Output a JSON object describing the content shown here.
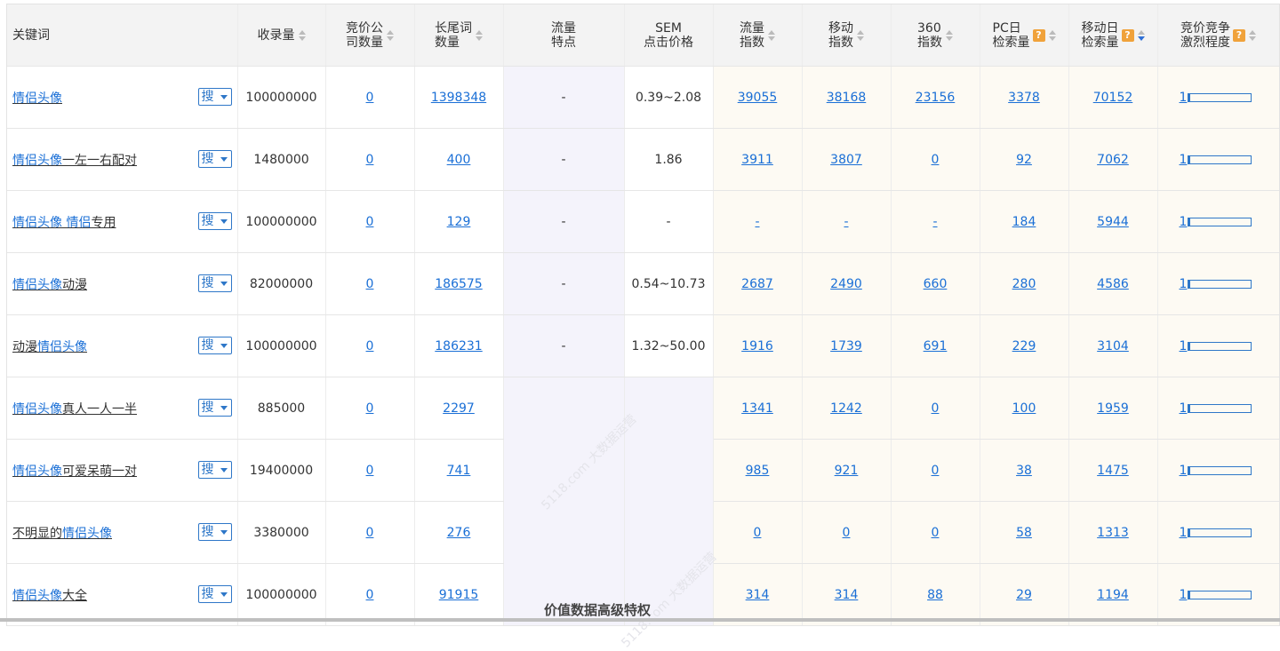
{
  "header": {
    "keyword": "关键词",
    "indexed": "收录量",
    "bid_companies": [
      "竞价公",
      "司数量"
    ],
    "longtail": [
      "长尾词",
      "数量"
    ],
    "traffic_feature": [
      "流量",
      "特点"
    ],
    "sem": [
      "SEM",
      "点击价格"
    ],
    "traffic_index": [
      "流量",
      "指数"
    ],
    "mobile_index": [
      "移动",
      "指数"
    ],
    "index_360": [
      "360",
      "指数"
    ],
    "pc_daily": [
      "PC日",
      "检索量"
    ],
    "mobile_daily": [
      "移动日",
      "检索量"
    ],
    "competition": [
      "竞价竞争",
      "激烈程度"
    ],
    "help_mark": "?"
  },
  "search_button_label": "搜",
  "rows": [
    {
      "kw_pre": "",
      "kw_hl": "情侣头像",
      "kw_post": "",
      "indexed": "100000000",
      "bid": "0",
      "longtail": "1398348",
      "feature": "-",
      "sem": "0.39~2.08",
      "traffic": "39055",
      "mobile": "38168",
      "i360": "23156",
      "pc": "3378",
      "mdaily": "70152",
      "comp": "1",
      "comp_level": 0.02
    },
    {
      "kw_pre": "",
      "kw_hl": "情侣头像",
      "kw_post": "一左一右配对",
      "indexed": "1480000",
      "bid": "0",
      "longtail": "400",
      "feature": "-",
      "sem": "1.86",
      "traffic": "3911",
      "mobile": "3807",
      "i360": "0",
      "pc": "92",
      "mdaily": "7062",
      "comp": "1",
      "comp_level": 0.02
    },
    {
      "kw_pre": "",
      "kw_hl": "情侣头像 情侣",
      "kw_post": "专用",
      "indexed": "100000000",
      "bid": "0",
      "longtail": "129",
      "feature": "-",
      "sem": "-",
      "traffic": "-",
      "mobile": "-",
      "i360": "-",
      "pc": "184",
      "mdaily": "5944",
      "comp": "1",
      "comp_level": 0.02
    },
    {
      "kw_pre": "",
      "kw_hl": "情侣头像",
      "kw_post": "动漫",
      "indexed": "82000000",
      "bid": "0",
      "longtail": "186575",
      "feature": "-",
      "sem": "0.54~10.73",
      "traffic": "2687",
      "mobile": "2490",
      "i360": "660",
      "pc": "280",
      "mdaily": "4586",
      "comp": "1",
      "comp_level": 0.02
    },
    {
      "kw_pre": "动漫",
      "kw_hl": "情侣头像",
      "kw_post": "",
      "indexed": "100000000",
      "bid": "0",
      "longtail": "186231",
      "feature": "-",
      "sem": "1.32~50.00",
      "traffic": "1916",
      "mobile": "1739",
      "i360": "691",
      "pc": "229",
      "mdaily": "3104",
      "comp": "1",
      "comp_level": 0.02
    },
    {
      "kw_pre": "",
      "kw_hl": "情侣头像",
      "kw_post": "真人一人一半",
      "indexed": "885000",
      "bid": "0",
      "longtail": "2297",
      "feature": "",
      "sem": "",
      "traffic": "1341",
      "mobile": "1242",
      "i360": "0",
      "pc": "100",
      "mdaily": "1959",
      "comp": "1",
      "comp_level": 0.02
    },
    {
      "kw_pre": "",
      "kw_hl": "情侣头像",
      "kw_post": "可爱呆萌一对",
      "indexed": "19400000",
      "bid": "0",
      "longtail": "741",
      "feature": "",
      "sem": "",
      "traffic": "985",
      "mobile": "921",
      "i360": "0",
      "pc": "38",
      "mdaily": "1475",
      "comp": "1",
      "comp_level": 0.02
    },
    {
      "kw_pre": "不明显的",
      "kw_hl": "情侣头像",
      "kw_post": "",
      "indexed": "3380000",
      "bid": "0",
      "longtail": "276",
      "feature": "",
      "sem": "",
      "traffic": "0",
      "mobile": "0",
      "i360": "0",
      "pc": "58",
      "mdaily": "1313",
      "comp": "1",
      "comp_level": 0.02
    },
    {
      "kw_pre": "",
      "kw_hl": "情侣头像",
      "kw_post": "大全",
      "indexed": "100000000",
      "bid": "0",
      "longtail": "91915",
      "feature": "",
      "sem": "",
      "traffic": "314",
      "mobile": "314",
      "i360": "88",
      "pc": "29",
      "mdaily": "1194",
      "comp": "1",
      "comp_level": 0.02
    }
  ],
  "watermark": "5118.com 大数据运营",
  "overlay": "价值数据高级特权",
  "colors": {
    "link": "#1a6fd6",
    "accent": "#2e77c8",
    "help": "#f0a23b"
  }
}
